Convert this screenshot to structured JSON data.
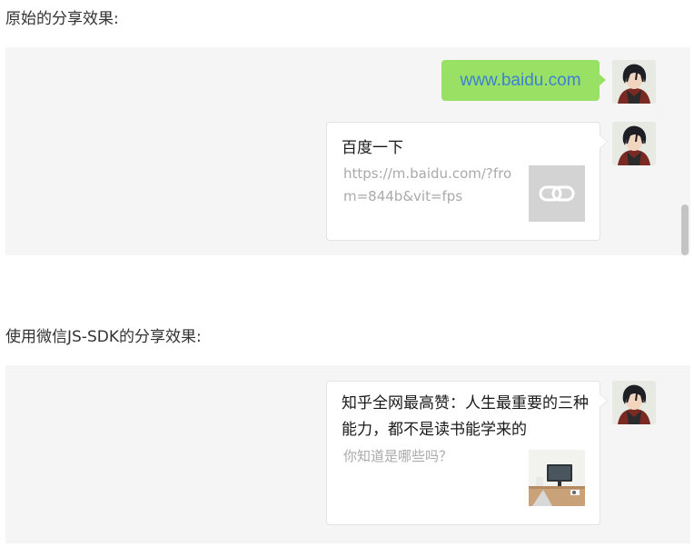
{
  "sections": [
    {
      "heading": "原始的分享效果:",
      "text_message": "www.baidu.com",
      "card": {
        "title": "百度一下",
        "description": "https://m.baidu.com/?from=844b&vit=fps",
        "thumbnail_icon": "link-icon"
      }
    },
    {
      "heading": "使用微信JS-SDK的分享效果:",
      "card": {
        "title": "知乎全网最高赞：人生最重要的三种能力，都不是读书能学来的",
        "description": "你知道是哪些吗？",
        "thumbnail_icon": "desk-photo-thumbnail"
      }
    }
  ],
  "colors": {
    "bubble_green": "#98e165",
    "link_blue": "#3f7fd4",
    "panel_bg": "#f5f5f5",
    "card_bg": "#ffffff",
    "muted_text": "#aaaaaa"
  }
}
